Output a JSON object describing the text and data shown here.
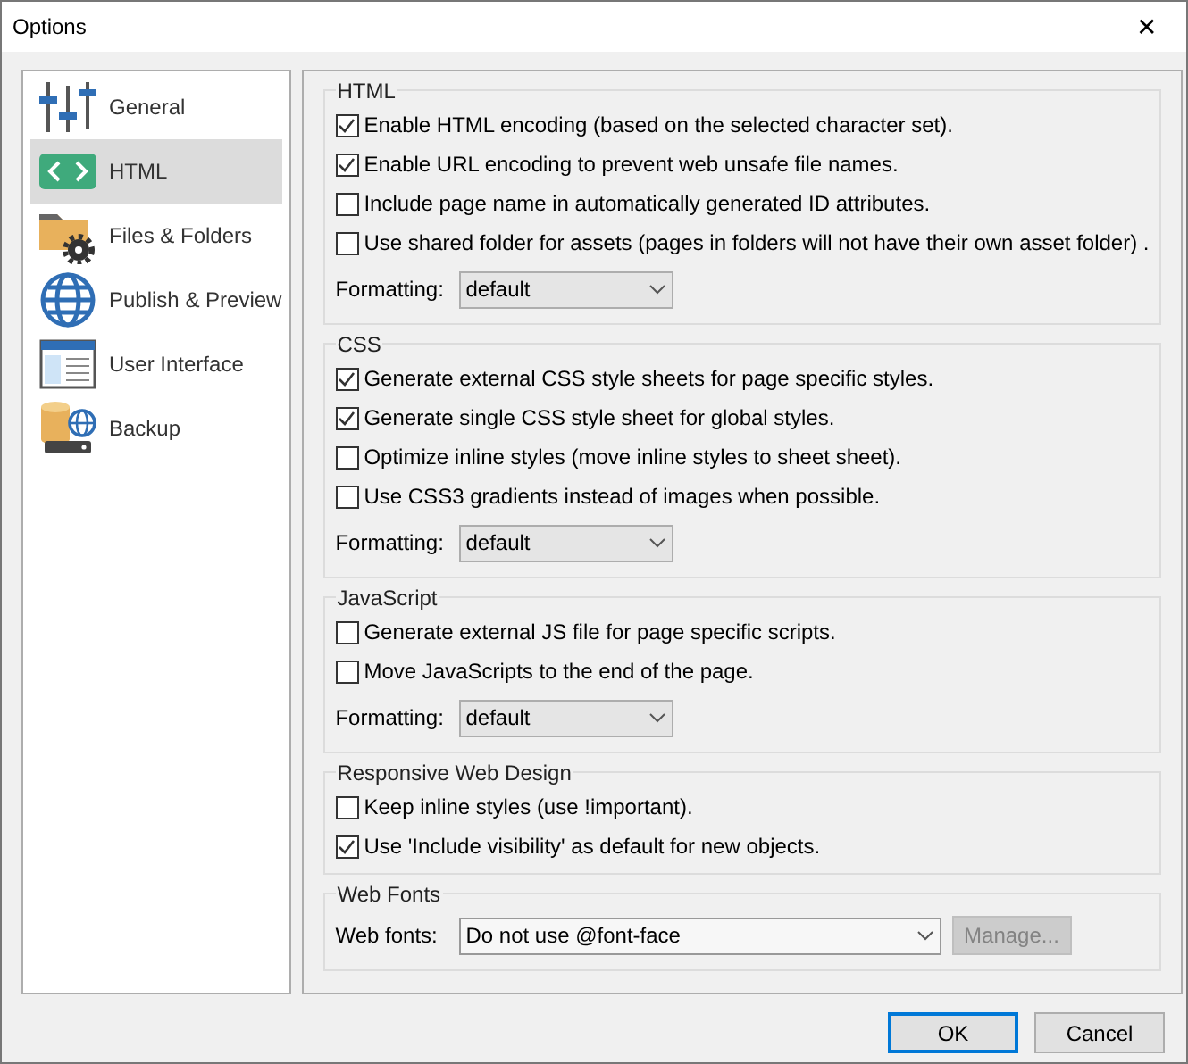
{
  "window": {
    "title": "Options",
    "close": "✕"
  },
  "sidebar": {
    "items": [
      {
        "label": "General",
        "selected": false
      },
      {
        "label": "HTML",
        "selected": true
      },
      {
        "label": "Files & Folders",
        "selected": false
      },
      {
        "label": "Publish & Preview",
        "selected": false
      },
      {
        "label": "User Interface",
        "selected": false
      },
      {
        "label": "Backup",
        "selected": false
      }
    ]
  },
  "sections": [
    {
      "title": "HTML",
      "options": [
        {
          "label": "Enable HTML encoding (based on the selected character set).",
          "checked": true
        },
        {
          "label": "Enable URL encoding to prevent web unsafe file names.",
          "checked": true
        },
        {
          "label": "Include page name in automatically generated ID attributes.",
          "checked": false
        },
        {
          "label": "Use shared folder for assets (pages in folders will not have their own asset folder) .",
          "checked": false
        }
      ],
      "field": {
        "label": "Formatting:",
        "value": "default"
      }
    },
    {
      "title": "CSS",
      "options": [
        {
          "label": "Generate external CSS style sheets for page specific styles.",
          "checked": true
        },
        {
          "label": "Generate single CSS style sheet for global styles.",
          "checked": true
        },
        {
          "label": "Optimize inline styles (move inline styles to sheet sheet).",
          "checked": false
        },
        {
          "label": "Use CSS3 gradients instead of images when possible.",
          "checked": false
        }
      ],
      "field": {
        "label": "Formatting:",
        "value": "default"
      }
    },
    {
      "title": "JavaScript",
      "options": [
        {
          "label": "Generate external JS file for page specific scripts.",
          "checked": false
        },
        {
          "label": "Move JavaScripts to the end of the page.",
          "checked": false
        }
      ],
      "field": {
        "label": "Formatting:",
        "value": "default"
      }
    },
    {
      "title": "Responsive Web Design",
      "options": [
        {
          "label": "Keep inline styles (use !important).",
          "checked": false
        },
        {
          "label": "Use 'Include visibility' as default for new objects.",
          "checked": true
        }
      ]
    },
    {
      "title": "Web Fonts",
      "field": {
        "label": "Web fonts:",
        "value": "Do not use @font-face",
        "button": {
          "label": "Manage...",
          "disabled": true
        }
      }
    }
  ],
  "buttons": [
    {
      "label": "OK",
      "default": true
    },
    {
      "label": "Cancel",
      "default": false
    }
  ]
}
